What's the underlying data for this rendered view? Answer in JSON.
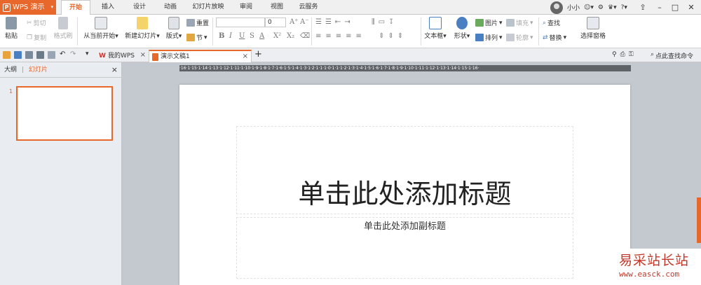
{
  "app": {
    "name": "WPS 演示",
    "logo_letter": "P",
    "accent": "#e8672b"
  },
  "menu_tabs": [
    "开始",
    "插入",
    "设计",
    "动画",
    "幻灯片放映",
    "审阅",
    "视图",
    "云服务"
  ],
  "user": {
    "name": "小小"
  },
  "ribbon": {
    "paste": "粘贴",
    "cut": "剪切",
    "copy": "复制",
    "format_painter": "格式刷",
    "from_current": "从当前开始",
    "new_slide": "新建幻灯片",
    "layout": "版式",
    "reset": "重置",
    "section": "节",
    "font_size": "0",
    "textbox": "文本框",
    "shape": "形状",
    "picture": "图片",
    "fill": "填充",
    "arrange": "排列",
    "outline": "轮廓",
    "find": "查找",
    "replace": "替换",
    "selection_pane": "选择窗格",
    "bold": "B",
    "italic": "I",
    "underline": "U",
    "strike": "S",
    "font_color": "A",
    "superscript": "X²",
    "subscript": "X₂"
  },
  "doc_tabs": [
    {
      "label": "我的WPS"
    },
    {
      "label": "演示文稿1"
    }
  ],
  "search_command": "点此查找命令",
  "side_tabs": {
    "outline": "大纲",
    "separator": "|",
    "slides": "幻灯片"
  },
  "slide_number": "1",
  "ruler_text": "·16·1·15·1·14·1·13·1·12·1·11·1·10·1·9·1·8·1·7·1·6·1·5·1·4·1·3·1·2·1·1·1·0·1·1·1·2·1·3·1·4·1·5·1·6·1·7·1·8·1·9·1·10·1·11·1·12·1·13·1·14·1·15·1·16·",
  "slide": {
    "title_placeholder": "单击此处添加标题",
    "subtitle_placeholder": "单击此处添加副标题"
  },
  "watermark": {
    "line1": "易采站长站",
    "line2": "www.easck.com"
  }
}
